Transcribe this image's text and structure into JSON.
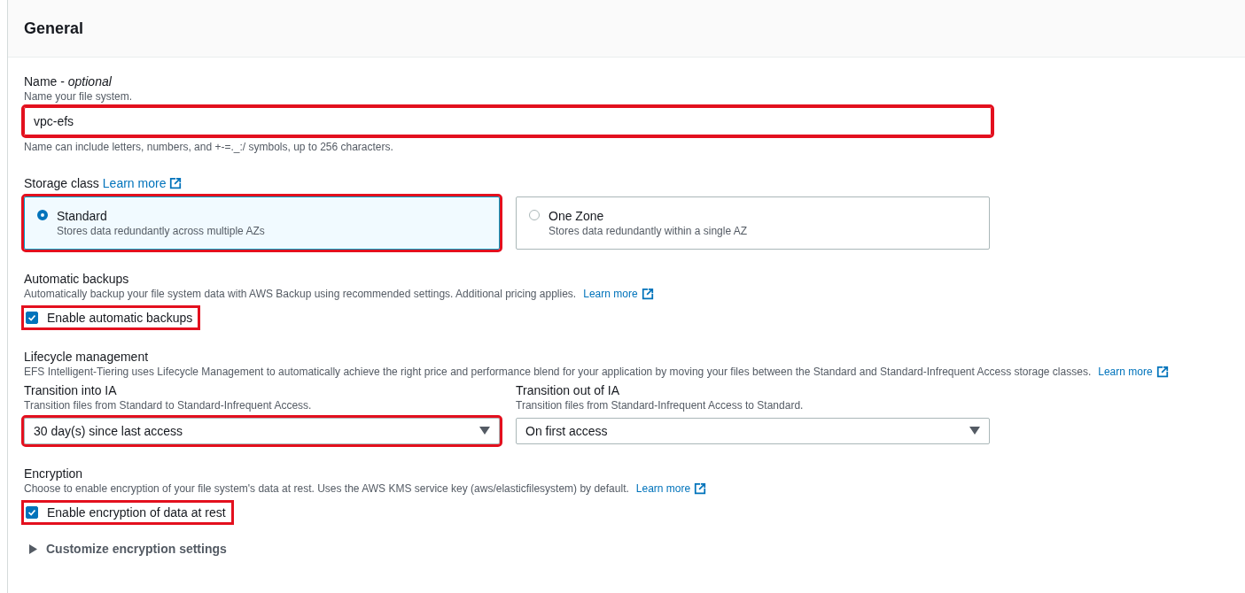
{
  "panel": {
    "title": "General"
  },
  "name_field": {
    "label": "Name - *optional*",
    "description": "Name your file system.",
    "value": "vpc-efs",
    "constraint": "Name can include letters, numbers, and +-=._:/ symbols, up to 256 characters.",
    "highlighted": true
  },
  "storage_class": {
    "label": "Storage class",
    "link": "Learn more",
    "options": [
      {
        "title": "Standard",
        "description": "Stores data redundantly across multiple AZs",
        "selected": true,
        "highlighted": true
      },
      {
        "title": "One Zone",
        "description": "Stores data redundantly within a single AZ",
        "selected": false,
        "highlighted": false
      }
    ]
  },
  "automatic_backups": {
    "label": "Automatic backups",
    "description": "Automatically backup your file system data with AWS Backup using recommended settings. Additional pricing applies.",
    "link": "Learn more",
    "checkbox": {
      "label": "Enable automatic backups",
      "checked": true,
      "highlighted": true
    }
  },
  "lifecycle": {
    "label": "Lifecycle management",
    "description": "EFS Intelligent-Tiering uses Lifecycle Management to automatically achieve the right price and performance blend for your application by moving your files between the Standard and Standard-Infrequent Access storage classes.",
    "link": "Learn more",
    "selects": [
      {
        "label": "Transition into IA",
        "description": "Transition files from Standard to Standard-Infrequent Access.",
        "value": "30 day(s) since last access",
        "highlighted": true
      },
      {
        "label": "Transition out of IA",
        "description": "Transition files from Standard-Infrequent Access to Standard.",
        "value": "On first access",
        "highlighted": false
      }
    ]
  },
  "encryption": {
    "label": "Encryption",
    "description": "Choose to enable encryption of your file system's data at rest. Uses the AWS KMS service key (aws/elasticfilesystem) by default.",
    "link": "Learn more",
    "checkbox": {
      "label": "Enable encryption of data at rest",
      "checked": true,
      "highlighted": true
    },
    "expander": {
      "label": "Customize encryption settings",
      "expanded": false
    }
  }
}
